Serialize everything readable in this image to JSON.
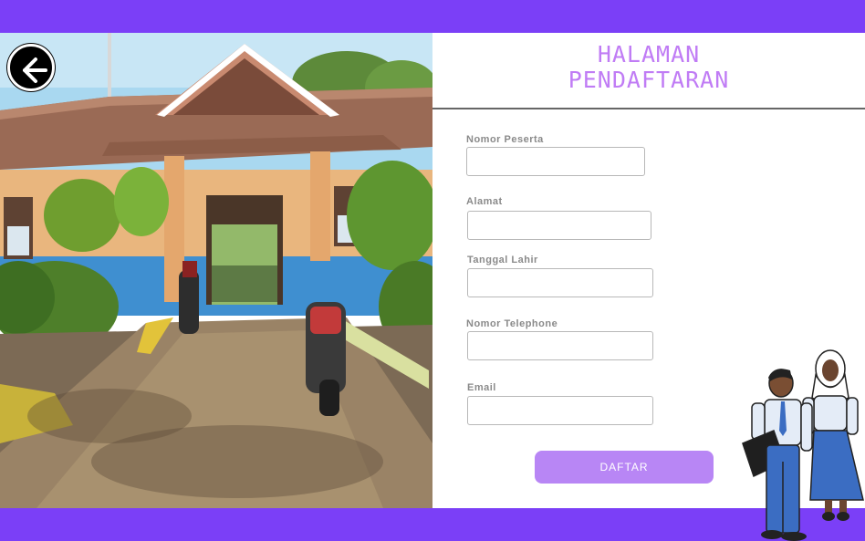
{
  "page": {
    "title_line1": "HALAMAN",
    "title_line2": "PENDAFTARAN",
    "accent_color": "#7b3ff7",
    "title_color": "#c07cf5",
    "button_color": "#b886f5"
  },
  "back_button": {
    "icon": "arrow-left-icon"
  },
  "form": {
    "fields": [
      {
        "label": "Nomor Peserta",
        "value": ""
      },
      {
        "label": "Alamat",
        "value": ""
      },
      {
        "label": "Tanggal Lahir",
        "value": ""
      },
      {
        "label": "Nomor Telephone",
        "value": ""
      },
      {
        "label": "Email",
        "value": ""
      }
    ],
    "submit_label": "DAFTAR"
  },
  "images": {
    "school_photo": "school-building-photo",
    "students_illustration": "students-illustration"
  }
}
